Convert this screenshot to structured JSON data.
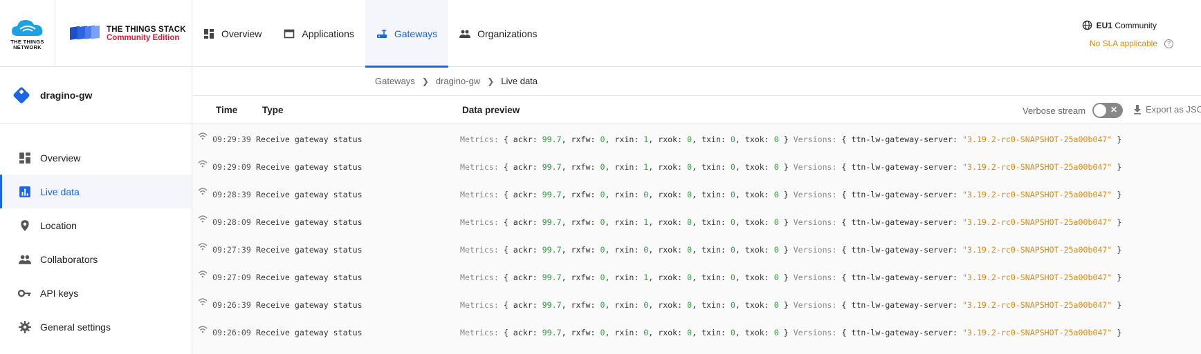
{
  "brand": {
    "ttn_line1": "THE THINGS",
    "ttn_line2": "NETWORK",
    "tts_line1": "THE THINGS STACK",
    "tts_line2": "Community Edition"
  },
  "nav": [
    {
      "label": "Overview",
      "icon": "dashboard-icon"
    },
    {
      "label": "Applications",
      "icon": "window-icon"
    },
    {
      "label": "Gateways",
      "icon": "router-icon",
      "active": true
    },
    {
      "label": "Organizations",
      "icon": "people-icon"
    }
  ],
  "cluster": {
    "region": "EU1",
    "tier": "Community",
    "sla": "No SLA applicable",
    "help": "?"
  },
  "gateway": {
    "name": "dragino-gw"
  },
  "sidebar": [
    {
      "label": "Overview",
      "icon": "dashboard-icon"
    },
    {
      "label": "Live data",
      "icon": "chart-icon",
      "active": true
    },
    {
      "label": "Location",
      "icon": "location-pin-icon"
    },
    {
      "label": "Collaborators",
      "icon": "people-icon"
    },
    {
      "label": "API keys",
      "icon": "key-icon"
    },
    {
      "label": "General settings",
      "icon": "gear-icon"
    }
  ],
  "breadcrumb": [
    "Gateways",
    "dragino-gw",
    "Live data"
  ],
  "table": {
    "col_time": "Time",
    "col_type": "Type",
    "col_preview": "Data preview",
    "verbose_label": "Verbose stream",
    "verbose_toggle": "✕",
    "export_label": "Export as JSON"
  },
  "events": [
    {
      "time": "09:29:39",
      "type": "Receive gateway status",
      "rxin": "1"
    },
    {
      "time": "09:29:09",
      "type": "Receive gateway status",
      "rxin": "1"
    },
    {
      "time": "09:28:39",
      "type": "Receive gateway status",
      "rxin": "0"
    },
    {
      "time": "09:28:09",
      "type": "Receive gateway status",
      "rxin": "1"
    },
    {
      "time": "09:27:39",
      "type": "Receive gateway status",
      "rxin": "0"
    },
    {
      "time": "09:27:09",
      "type": "Receive gateway status",
      "rxin": "1"
    },
    {
      "time": "09:26:39",
      "type": "Receive gateway status",
      "rxin": "0"
    },
    {
      "time": "09:26:09",
      "type": "Receive gateway status",
      "rxin": "0"
    }
  ],
  "preview_common": {
    "metrics_label": "Metrics:",
    "ackr": "99.7",
    "rxfw": "0",
    "rxok": "0",
    "txin": "0",
    "txok": "0",
    "versions_label": "Versions:",
    "server_key": "ttn-lw-gateway-server:",
    "server_version": "\"3.19.2-rc0-SNAPSHOT-25a00b047\""
  },
  "colors": {
    "accent": "#1a66e3",
    "brand_red": "#d6203c",
    "number": "#2e9e3e",
    "string": "#d98b0b"
  }
}
